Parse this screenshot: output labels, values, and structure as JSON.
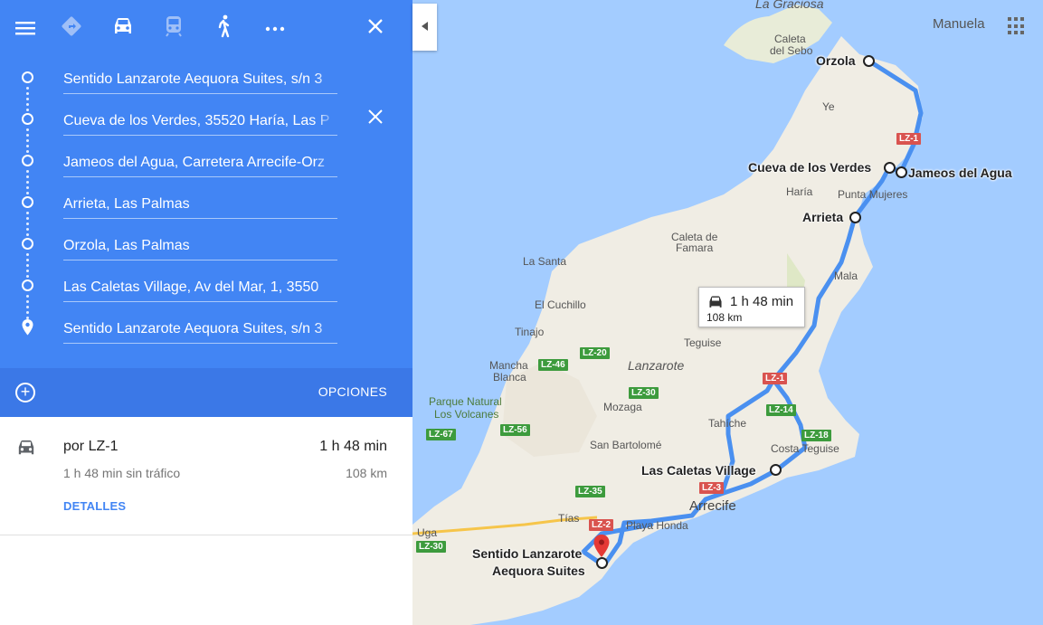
{
  "topbar": {
    "menu_icon": "menu-icon",
    "modes": [
      {
        "name": "best-route",
        "icon": "diamond-directions-icon",
        "active": false
      },
      {
        "name": "car",
        "icon": "car-icon",
        "active": true
      },
      {
        "name": "transit",
        "icon": "train-icon",
        "active": false
      },
      {
        "name": "walking",
        "icon": "walk-icon",
        "active": false
      },
      {
        "name": "more",
        "icon": "more-icon",
        "active": false
      }
    ],
    "close_icon": "close-icon"
  },
  "waypoints": [
    "Sentido Lanzarote Aequora Suites, s/n 3",
    "Cueva de los Verdes, 35520 Haría, Las P",
    "Jameos del Agua, Carretera Arrecife-Orz",
    "Arrieta, Las Palmas",
    "Orzola, Las Palmas",
    "Las Caletas Village, Av del Mar, 1, 3550",
    "Sentido Lanzarote Aequora Suites, s/n 3"
  ],
  "options_label": "OPCIONES",
  "route": {
    "via": "por LZ-1",
    "time": "1 h 48 min",
    "subtitle": "1 h 48 min sin tráfico",
    "distance": "108 km",
    "details": "DETALLES"
  },
  "map": {
    "user": "Manuela",
    "duration": "1 h 48 min",
    "distance": "108 km",
    "places": [
      {
        "text": "La Graciosa",
        "style": "italic"
      },
      {
        "text": "Caleta",
        "style": "small"
      },
      {
        "text": "del Sebo",
        "style": "small"
      },
      {
        "text": "Ye",
        "style": "small"
      },
      {
        "text": "Haría",
        "style": "small"
      },
      {
        "text": "Punta Mujeres",
        "style": "small"
      },
      {
        "text": "Caleta de",
        "style": "small"
      },
      {
        "text": "Famara",
        "style": "small"
      },
      {
        "text": "La Santa",
        "style": "small"
      },
      {
        "text": "Mala",
        "style": "small"
      },
      {
        "text": "El Cuchillo",
        "style": "small"
      },
      {
        "text": "Tinajo",
        "style": "small"
      },
      {
        "text": "Teguise",
        "style": "small"
      },
      {
        "text": "Lanzarote",
        "style": "italic"
      },
      {
        "text": "Mancha",
        "style": "small"
      },
      {
        "text": "Blanca",
        "style": "small"
      },
      {
        "text": "Parque Natural",
        "style": "park"
      },
      {
        "text": "Los Volcanes",
        "style": "park"
      },
      {
        "text": "Mozaga",
        "style": "small"
      },
      {
        "text": "Tahíche",
        "style": "small"
      },
      {
        "text": "Costa Teguise",
        "style": "small"
      },
      {
        "text": "San Bartolomé",
        "style": "small"
      },
      {
        "text": "Arrecife",
        "style": "city"
      },
      {
        "text": "Tías",
        "style": "small"
      },
      {
        "text": "Playa Honda",
        "style": "small"
      },
      {
        "text": "Uga",
        "style": "small"
      }
    ],
    "stops": [
      {
        "text": "Orzola"
      },
      {
        "text": "Cueva de los Verdes"
      },
      {
        "text": "Jameos del Agua"
      },
      {
        "text": "Arrieta"
      },
      {
        "text": "Las Caletas Village"
      },
      {
        "text": "Sentido Lanzarote"
      },
      {
        "text": "Aequora Suites"
      }
    ],
    "roads": [
      {
        "text": "LZ-1",
        "color": "#d9534f"
      },
      {
        "text": "LZ-20",
        "color": "#3d9b3d"
      },
      {
        "text": "LZ-46",
        "color": "#3d9b3d"
      },
      {
        "text": "LZ-1",
        "color": "#d9534f"
      },
      {
        "text": "LZ-30",
        "color": "#3d9b3d"
      },
      {
        "text": "LZ-14",
        "color": "#3d9b3d"
      },
      {
        "text": "LZ-18",
        "color": "#3d9b3d"
      },
      {
        "text": "LZ-67",
        "color": "#3d9b3d"
      },
      {
        "text": "LZ-56",
        "color": "#3d9b3d"
      },
      {
        "text": "LZ-3",
        "color": "#d9534f"
      },
      {
        "text": "LZ-35",
        "color": "#3d9b3d"
      },
      {
        "text": "LZ-2",
        "color": "#d9534f"
      },
      {
        "text": "LZ-30",
        "color": "#3d9b3d"
      }
    ]
  },
  "colors": {
    "accent": "#4285f4",
    "route": "#4a90f0",
    "sea": "#a3ccff",
    "land": "#f2efe9"
  }
}
